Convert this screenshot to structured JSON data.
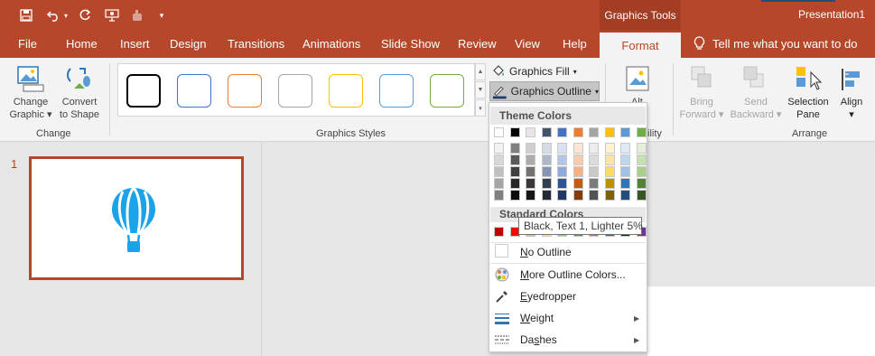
{
  "title_bar": {
    "context_tab_header": "Graphics Tools",
    "app_title": "Presentation1"
  },
  "tabs": [
    "File",
    "Home",
    "Insert",
    "Design",
    "Transitions",
    "Animations",
    "Slide Show",
    "Review",
    "View",
    "Help",
    "Format"
  ],
  "tell_me": "Tell me what you want to do",
  "ribbon": {
    "change_graphic": {
      "line1": "Change",
      "line2": "Graphic"
    },
    "convert_to_shape": {
      "line1": "Convert",
      "line2": "to Shape"
    },
    "group_change": "Change",
    "group_graphics_styles": "Graphics Styles",
    "graphics_fill": "Graphics Fill",
    "graphics_outline": "Graphics Outline",
    "alt_partial": "Alt",
    "accessibility_partial": "ility",
    "bring_forward": {
      "line1": "Bring",
      "line2": "Forward"
    },
    "send_backward": {
      "line1": "Send",
      "line2": "Backward"
    },
    "selection_pane": {
      "line1": "Selection",
      "line2": "Pane"
    },
    "align": "Align",
    "group_arrange": "Arrange",
    "style_swatch_colors": [
      "#000000",
      "#4472c4",
      "#ed7d31",
      "#a5a5a5",
      "#ffc000",
      "#5b9bd5",
      "#70ad47"
    ]
  },
  "slides": {
    "number": "1",
    "thumbnail_icon": "hot-air-balloon-icon",
    "icon_color": "#1aa3e8"
  },
  "dropdown": {
    "theme_colors_header": "Theme Colors",
    "theme_top_row": [
      "#ffffff",
      "#000000",
      "#e7e6e6",
      "#44546a",
      "#4472c4",
      "#ed7d31",
      "#a5a5a5",
      "#ffc000",
      "#5b9bd5",
      "#70ad47"
    ],
    "theme_shade_rows": [
      [
        "#f2f2f2",
        "#7f7f7f",
        "#d0cece",
        "#d6dce4",
        "#d9e2f3",
        "#fbe5d5",
        "#ededed",
        "#fff2cc",
        "#deebf6",
        "#e2efd9"
      ],
      [
        "#d8d8d8",
        "#595959",
        "#aeabab",
        "#adb9ca",
        "#b4c6e7",
        "#f7cbac",
        "#dbdbdb",
        "#fee599",
        "#bdd7ee",
        "#c5e0b3"
      ],
      [
        "#bfbfbf",
        "#3f3f3f",
        "#757070",
        "#8496b0",
        "#8eaadb",
        "#f4b183",
        "#c9c9c9",
        "#ffd965",
        "#9cc3e5",
        "#a8d08d"
      ],
      [
        "#a5a5a5",
        "#262626",
        "#3a3838",
        "#323f4f",
        "#2f5496",
        "#c55a11",
        "#7b7b7b",
        "#bf9000",
        "#2e75b5",
        "#538135"
      ],
      [
        "#7f7f7f",
        "#0c0c0c",
        "#171616",
        "#222a35",
        "#1f3864",
        "#833c0b",
        "#525252",
        "#7f6000",
        "#1e4e79",
        "#375623"
      ]
    ],
    "standard_colors_header": "Standard Colors",
    "standard_colors": [
      "#c00000",
      "#ff0000",
      "#ffc000",
      "#ffff00",
      "#92d050",
      "#00b050",
      "#00b0f0",
      "#0070c0",
      "#002060",
      "#7030a0"
    ],
    "no_outline": "No Outline",
    "more_colors": "More Outline Colors...",
    "eyedropper": "Eyedropper",
    "weight": "Weight",
    "dashes": "Dashes",
    "tooltip": "Black, Text 1, Lighter 5%"
  }
}
